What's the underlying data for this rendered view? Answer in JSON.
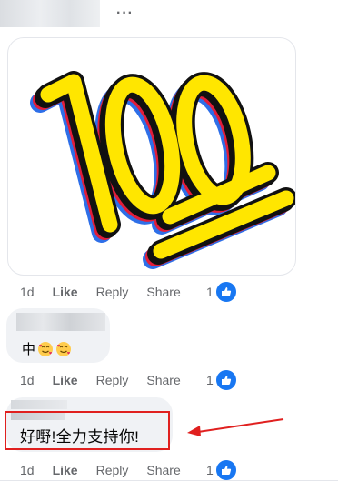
{
  "header": {
    "menu_label": "···"
  },
  "actions": {
    "time": "1d",
    "like": "Like",
    "reply": "Reply",
    "share": "Share",
    "reaction_count": "1"
  },
  "comments": [
    {
      "text": "中"
    },
    {
      "text": "好嘢!全力支持你!"
    }
  ],
  "colors": {
    "accent": "#1877f2",
    "highlight": "#e0201f",
    "sticker_yellow": "#ffe600"
  }
}
